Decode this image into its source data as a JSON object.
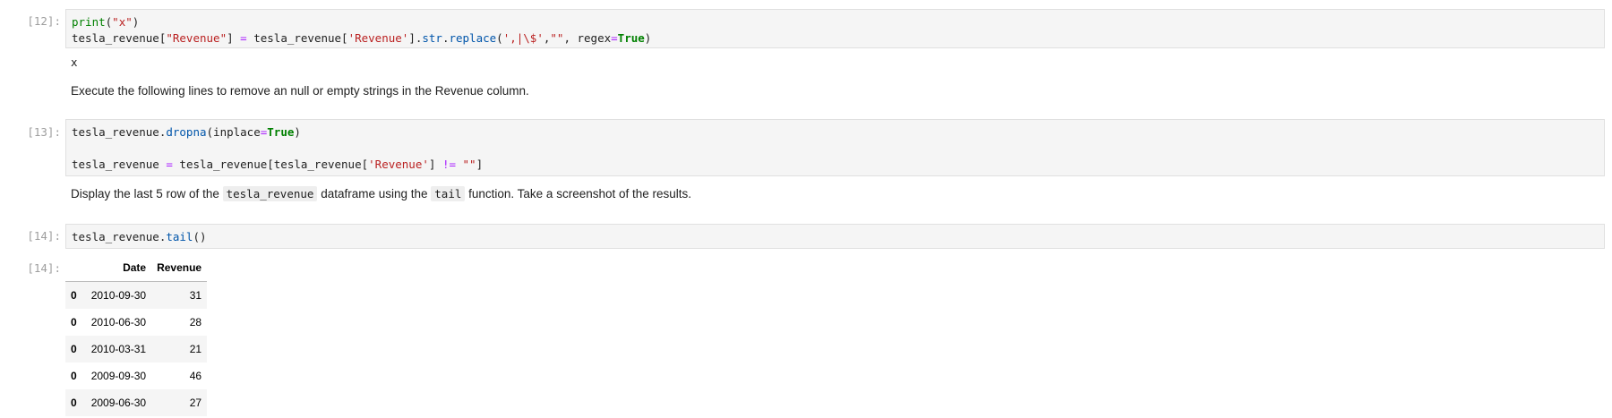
{
  "cells": [
    {
      "prompt": "[12]:",
      "lines": [
        {
          "parts": [
            {
              "t": "print",
              "c": "fn-plain"
            },
            {
              "t": "(",
              "c": "plain"
            },
            {
              "t": "\"x\"",
              "c": "str"
            },
            {
              "t": ")",
              "c": "plain"
            }
          ]
        },
        {
          "parts": [
            {
              "t": "tesla_revenue[",
              "c": "plain"
            },
            {
              "t": "\"Revenue\"",
              "c": "str"
            },
            {
              "t": "] ",
              "c": "plain"
            },
            {
              "t": "=",
              "c": "op"
            },
            {
              "t": " tesla_revenue[",
              "c": "plain"
            },
            {
              "t": "'Revenue'",
              "c": "str"
            },
            {
              "t": "].",
              "c": "plain"
            },
            {
              "t": "str",
              "c": "fn"
            },
            {
              "t": ".",
              "c": "plain"
            },
            {
              "t": "replace",
              "c": "fn"
            },
            {
              "t": "(",
              "c": "plain"
            },
            {
              "t": "',|\\$'",
              "c": "str"
            },
            {
              "t": ",",
              "c": "plain"
            },
            {
              "t": "\"\"",
              "c": "str"
            },
            {
              "t": ", regex",
              "c": "plain"
            },
            {
              "t": "=",
              "c": "op"
            },
            {
              "t": "True",
              "c": "k"
            },
            {
              "t": ")",
              "c": "plain"
            }
          ]
        }
      ],
      "stdout": "x"
    },
    {
      "prompt": "[13]:",
      "lines": [
        {
          "parts": [
            {
              "t": "tesla_revenue.",
              "c": "plain"
            },
            {
              "t": "dropna",
              "c": "fn"
            },
            {
              "t": "(inplace",
              "c": "plain"
            },
            {
              "t": "=",
              "c": "op"
            },
            {
              "t": "True",
              "c": "k"
            },
            {
              "t": ")",
              "c": "plain"
            }
          ]
        },
        {
          "parts": []
        },
        {
          "parts": [
            {
              "t": "tesla_revenue ",
              "c": "plain"
            },
            {
              "t": "=",
              "c": "op"
            },
            {
              "t": " tesla_revenue[tesla_revenue[",
              "c": "plain"
            },
            {
              "t": "'Revenue'",
              "c": "str"
            },
            {
              "t": "] ",
              "c": "plain"
            },
            {
              "t": "!=",
              "c": "op"
            },
            {
              "t": " ",
              "c": "plain"
            },
            {
              "t": "\"\"",
              "c": "str"
            },
            {
              "t": "]",
              "c": "plain"
            }
          ]
        }
      ]
    },
    {
      "prompt": "[14]:",
      "lines": [
        {
          "parts": [
            {
              "t": "tesla_revenue.",
              "c": "plain"
            },
            {
              "t": "tail",
              "c": "fn"
            },
            {
              "t": "()",
              "c": "plain"
            }
          ]
        }
      ]
    }
  ],
  "markdown": {
    "md1": "Execute the following lines to remove an null or empty strings in the Revenue column.",
    "md2_pre": "Display the last 5 row of the ",
    "md2_code1": "tesla_revenue",
    "md2_mid": " dataframe using the ",
    "md2_code2": "tail",
    "md2_post": " function. Take a screenshot of the results."
  },
  "output": {
    "prompt": "[14]:",
    "columns": [
      "",
      "Date",
      "Revenue"
    ],
    "rows": [
      {
        "index": "0",
        "date": "2010-09-30",
        "revenue": "31"
      },
      {
        "index": "0",
        "date": "2010-06-30",
        "revenue": "28"
      },
      {
        "index": "0",
        "date": "2010-03-31",
        "revenue": "21"
      },
      {
        "index": "0",
        "date": "2009-09-30",
        "revenue": "46"
      },
      {
        "index": "0",
        "date": "2009-06-30",
        "revenue": "27"
      }
    ]
  }
}
